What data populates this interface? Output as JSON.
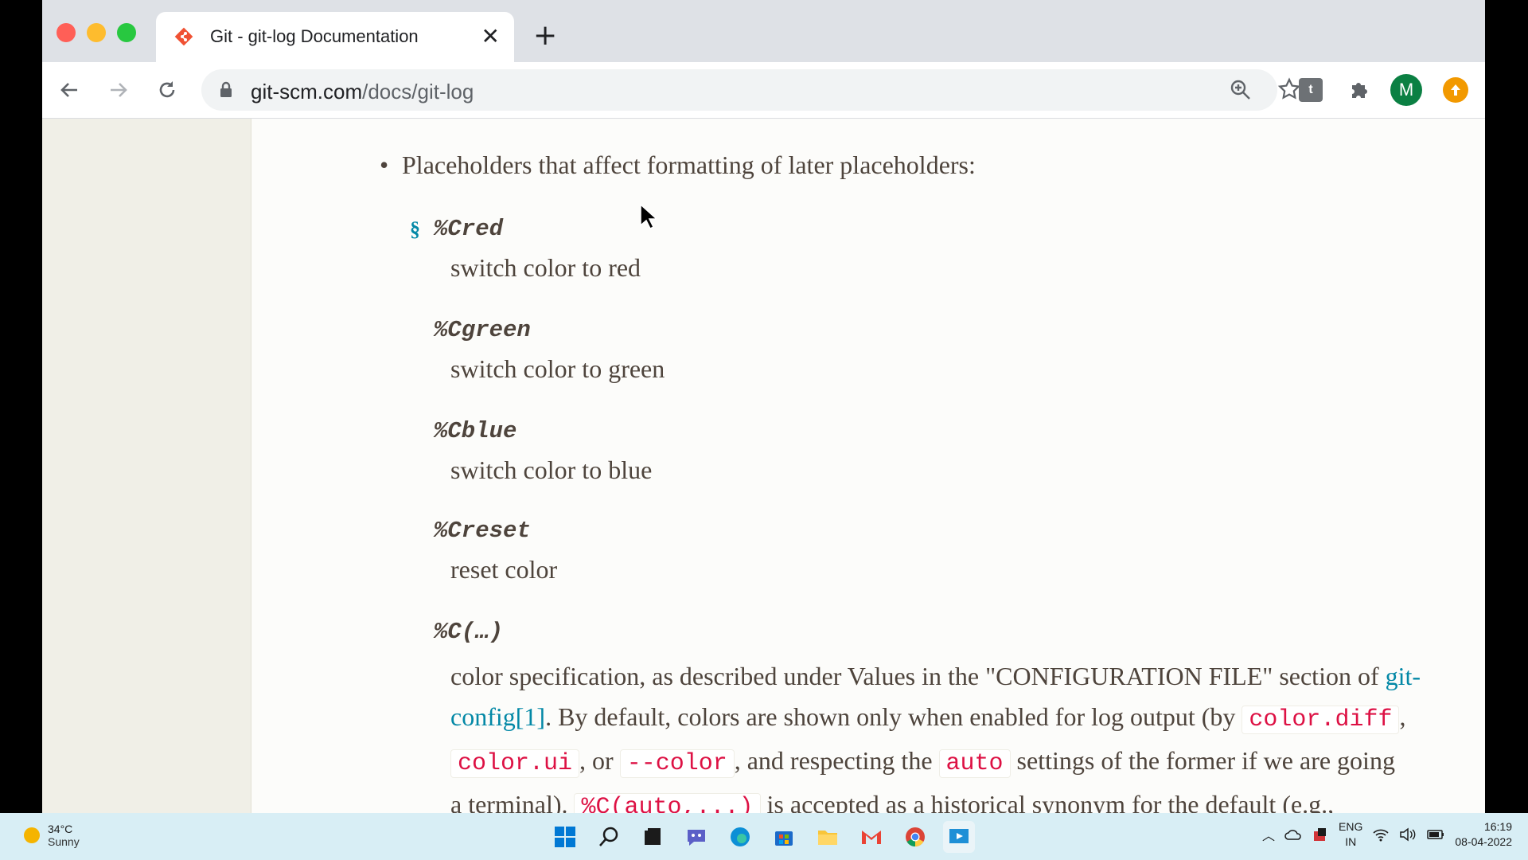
{
  "browser": {
    "tab_title": "Git - git-log Documentation",
    "tab_close": "✕",
    "new_tab": "+",
    "url_host": "git-scm.com",
    "url_path": "/docs/git-log",
    "avatar_letter": "M"
  },
  "window_controls": {
    "minimize": "–",
    "restore": "❐",
    "close": "✕"
  },
  "doc": {
    "bullet_text": "Placeholders that affect formatting of later placeholders:",
    "anchor": "§",
    "entries": [
      {
        "term": "%Cred",
        "desc": "switch color to red"
      },
      {
        "term": "%Cgreen",
        "desc": "switch color to green"
      },
      {
        "term": "%Cblue",
        "desc": "switch color to blue"
      },
      {
        "term": "%Creset",
        "desc": "reset color"
      },
      {
        "term": "%C(…)"
      }
    ],
    "para": {
      "l1": "color specification, as described under Values in the \"CONFIGURATION FILE\" section of ",
      "link1": "git-",
      "link2": "config[1]",
      "l2": ". By default, colors are shown only when enabled for log output (by ",
      "code1": "color.diff",
      "comma": ",",
      "code2": "color.ui",
      "l3a": ", or ",
      "code3": "--color",
      "l3b": ", and respecting the ",
      "code4": "auto",
      "l3c": " settings of the former if we are going",
      "l4a": "a terminal). ",
      "code5": "%C(auto,...)",
      "l4b": " is accepted as a historical synonym for the default (e.g.,"
    }
  },
  "taskbar": {
    "temp": "34°C",
    "weather": "Sunny",
    "lang1": "ENG",
    "lang2": "IN",
    "time": "16:19",
    "date": "08-04-2022"
  },
  "colors": {
    "accent_link": "#0388a6",
    "code_red": "#dd1144",
    "git_orange": "#f05133"
  }
}
